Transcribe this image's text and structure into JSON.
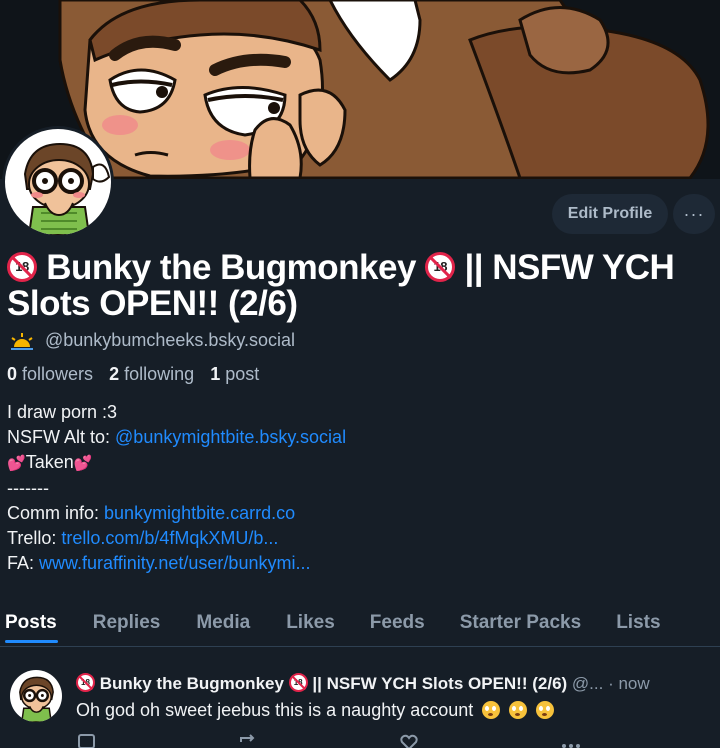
{
  "profile": {
    "display_name_part1": "Bunky the Bugmonkey",
    "display_name_part2": "|| NSFW YCH Slots OPEN!! (2/6)",
    "badge_text": "18",
    "handle": "@bunkybumcheeks.bsky.social",
    "handle_icon": "sun-icon",
    "followers_count": "0",
    "followers_label": "followers",
    "following_count": "2",
    "following_label": "following",
    "posts_count": "1",
    "posts_label": "post"
  },
  "actions": {
    "edit_profile_label": "Edit Profile",
    "more_label": "···"
  },
  "bio": {
    "line1": "I draw porn :3",
    "alt_prefix": "NSFW Alt to: ",
    "alt_link": "@bunkymightbite.bsky.social",
    "taken_label": "Taken",
    "separator": "-------",
    "comm_prefix": "Comm info: ",
    "comm_link": "bunkymightbite.carrd.co",
    "trello_prefix": "Trello: ",
    "trello_link": "trello.com/b/4fMqkXMU/b...",
    "fa_prefix": "FA: ",
    "fa_link": "www.furaffinity.net/user/bunkymi..."
  },
  "tabs": [
    {
      "label": "Posts",
      "active": true
    },
    {
      "label": "Replies"
    },
    {
      "label": "Media"
    },
    {
      "label": "Likes"
    },
    {
      "label": "Feeds"
    },
    {
      "label": "Starter Packs"
    },
    {
      "label": "Lists"
    }
  ],
  "post": {
    "author_name": "Bunky the Bugmonkey",
    "author_suffix": "|| NSFW YCH Slots OPEN!! (2/6)",
    "author_handle_truncated": "@...",
    "timestamp": "· now",
    "text": "Oh god oh sweet jeebus this is a naughty account"
  },
  "colors": {
    "background": "#161e27",
    "link": "#208bfe",
    "muted": "#8c9aa9",
    "button_bg": "#1e2936"
  }
}
